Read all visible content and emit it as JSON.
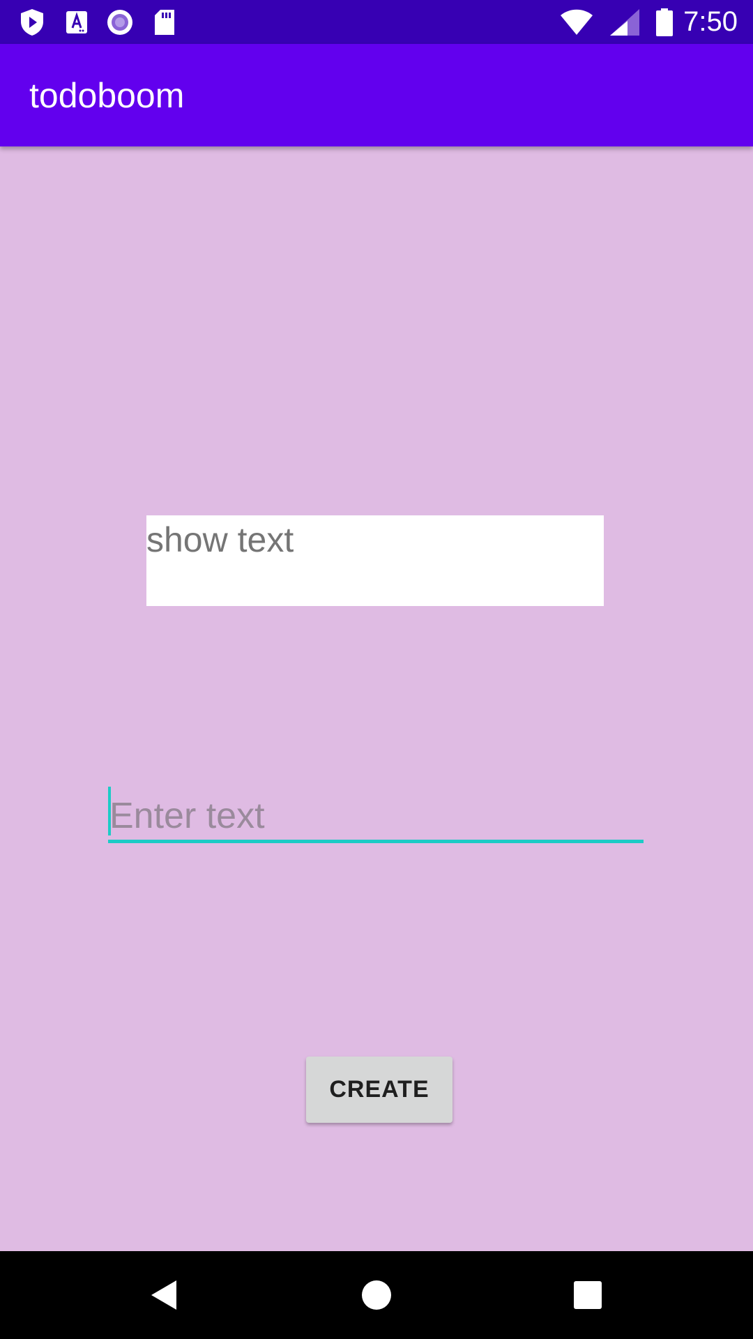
{
  "status_bar": {
    "time": "7:50",
    "left_icons": [
      "play-shield-icon",
      "font-a-icon",
      "circle-dot-icon",
      "sd-card-icon"
    ],
    "right_icons": [
      "wifi-icon",
      "signal-icon",
      "battery-icon"
    ]
  },
  "app_bar": {
    "title": "todoboom"
  },
  "main": {
    "display_text": "show text",
    "input": {
      "value": "",
      "placeholder": "Enter text"
    },
    "create_label": "CREATE"
  },
  "nav_bar": {
    "buttons": [
      "back-icon",
      "home-icon",
      "recents-icon"
    ]
  },
  "colors": {
    "status_bar": "#3700b3",
    "app_bar": "#6200ee",
    "background": "#dfbbe3",
    "accent": "#1ccbc6",
    "button": "#d6d7d7"
  }
}
